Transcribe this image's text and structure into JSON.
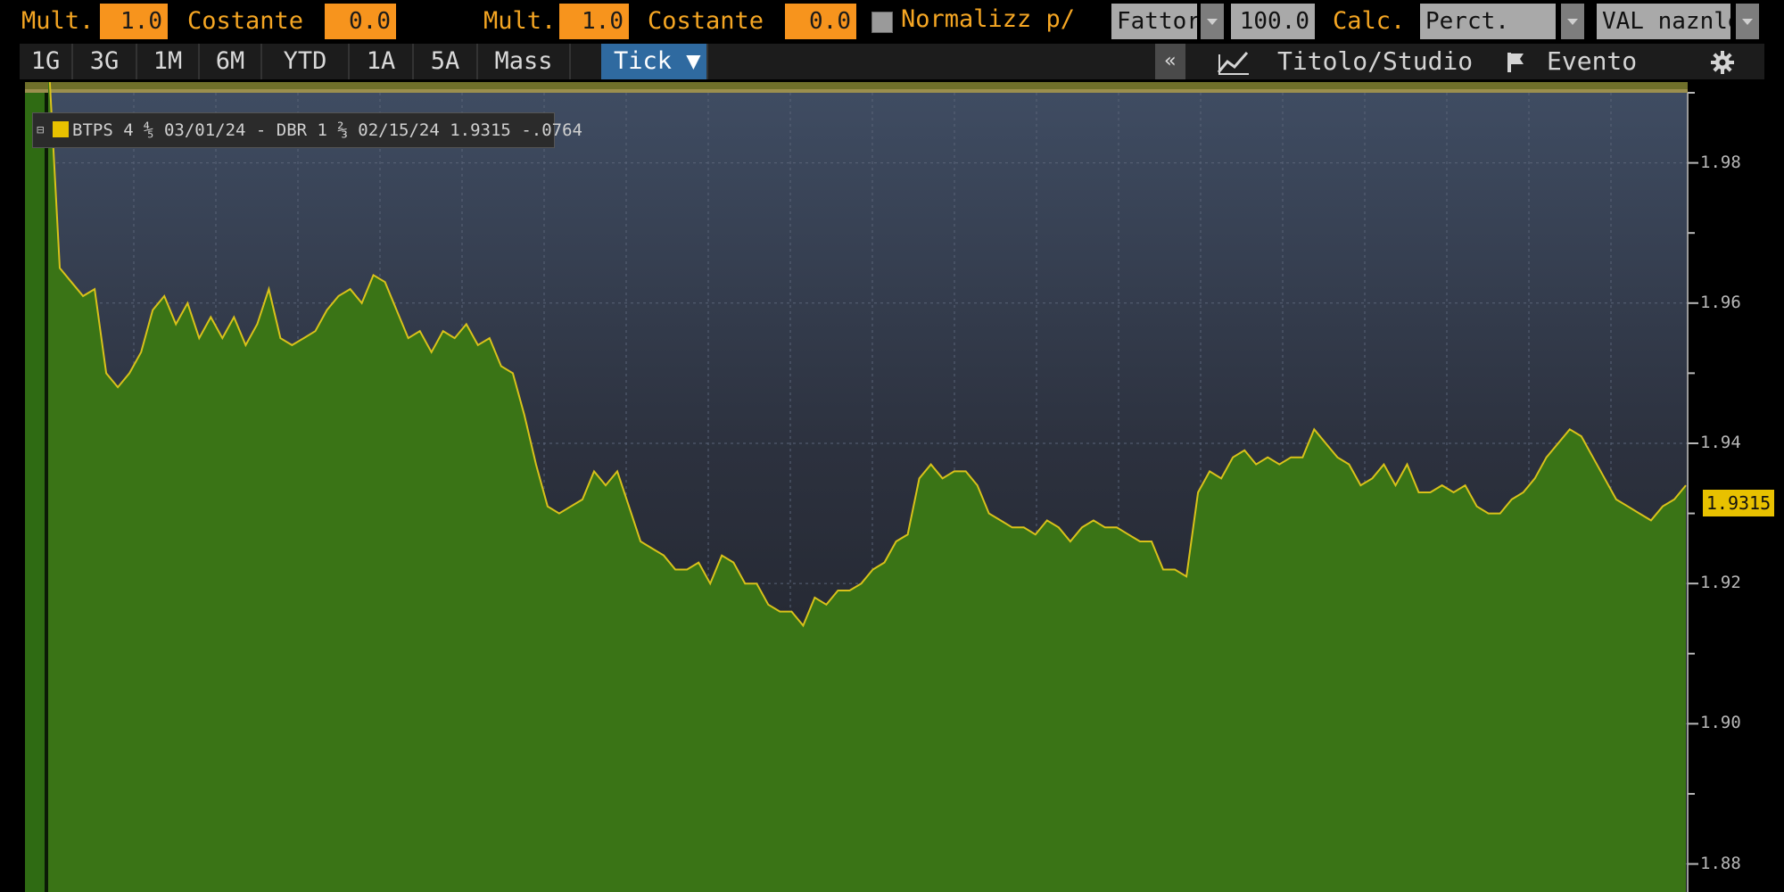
{
  "params": {
    "mult1_label": "Mult.",
    "mult1_value": "1.0",
    "const1_label": "Costante",
    "const1_value": "0.0",
    "mult2_label": "Mult.",
    "mult2_value": "1.0",
    "const2_label": "Costante",
    "const2_value": "0.0",
    "normalize_label": "Normalizz p/",
    "factor_label": "Fattor",
    "factor_value": "100.0",
    "calc_label": "Calc.",
    "calc_value": "Perct.",
    "val_value": "VAL naznle"
  },
  "range_bar": {
    "buttons": [
      "1G",
      "3G",
      "1M",
      "6M",
      "YTD",
      "1A",
      "5A",
      "Mass"
    ],
    "active_label": "Tick ▼",
    "collapse_label": "«",
    "title_study_label": "Titolo/Studio",
    "event_label": "Evento",
    "icons": [
      "chart-line-icon",
      "flag-icon",
      "gear-icon"
    ]
  },
  "legend": {
    "text": "BTPS 4 ⅘ 03/01/24 - DBR 1 ⅔ 02/15/24 1.9315  -.0764",
    "swatch_color": "#e8c100"
  },
  "colors": {
    "accent": "#f7941d",
    "series_fill": "#3a7416",
    "series_line": "#d9c21a",
    "active_tab": "#2f6aa0",
    "last_value_badge": "#e8c100"
  },
  "chart_data": {
    "type": "area",
    "title": "",
    "xlabel": "",
    "ylabel": "",
    "ylim": [
      1.876,
      1.99
    ],
    "y_ticks": [
      "1.98",
      "1.96",
      "1.94",
      "1.92",
      "1.90",
      "1.88"
    ],
    "last_value_label": "1.9315",
    "grid": true,
    "series": [
      {
        "name": "BTPS 4 ⅘ 03/01/24 - DBR 1 ⅔ 02/15/24",
        "values": [
          1.996,
          1.965,
          1.963,
          1.961,
          1.962,
          1.95,
          1.948,
          1.95,
          1.953,
          1.959,
          1.961,
          1.957,
          1.96,
          1.955,
          1.958,
          1.955,
          1.958,
          1.954,
          1.957,
          1.962,
          1.955,
          1.954,
          1.955,
          1.956,
          1.959,
          1.961,
          1.962,
          1.96,
          1.964,
          1.963,
          1.959,
          1.955,
          1.956,
          1.953,
          1.956,
          1.955,
          1.957,
          1.954,
          1.955,
          1.951,
          1.95,
          1.944,
          1.937,
          1.931,
          1.93,
          1.931,
          1.932,
          1.936,
          1.934,
          1.936,
          1.931,
          1.926,
          1.925,
          1.924,
          1.922,
          1.922,
          1.923,
          1.92,
          1.924,
          1.923,
          1.92,
          1.92,
          1.917,
          1.916,
          1.916,
          1.914,
          1.918,
          1.917,
          1.919,
          1.919,
          1.92,
          1.922,
          1.923,
          1.926,
          1.927,
          1.935,
          1.937,
          1.935,
          1.936,
          1.936,
          1.934,
          1.93,
          1.929,
          1.928,
          1.928,
          1.927,
          1.929,
          1.928,
          1.926,
          1.928,
          1.929,
          1.928,
          1.928,
          1.927,
          1.926,
          1.926,
          1.922,
          1.922,
          1.921,
          1.933,
          1.936,
          1.935,
          1.938,
          1.939,
          1.937,
          1.938,
          1.937,
          1.938,
          1.938,
          1.942,
          1.94,
          1.938,
          1.937,
          1.934,
          1.935,
          1.937,
          1.934,
          1.937,
          1.933,
          1.933,
          1.934,
          1.933,
          1.934,
          1.931,
          1.93,
          1.93,
          1.932,
          1.933,
          1.935,
          1.938,
          1.94,
          1.942,
          1.941,
          1.938,
          1.935,
          1.932,
          1.931,
          1.93,
          1.929,
          1.931,
          1.932,
          1.934
        ]
      }
    ]
  }
}
